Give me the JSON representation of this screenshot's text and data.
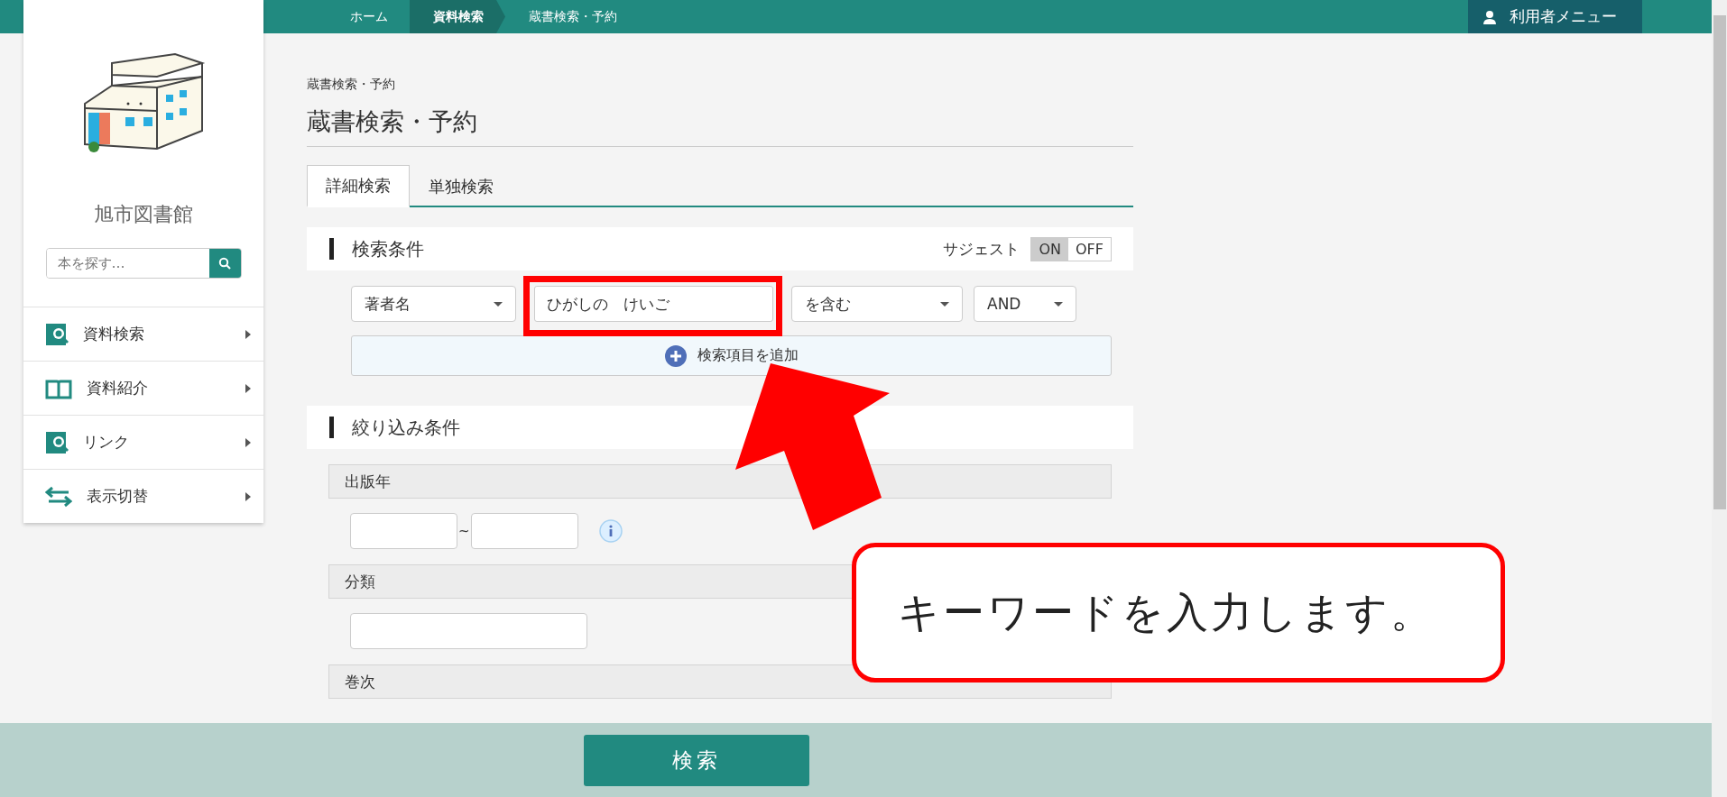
{
  "top_bar": {
    "breadcrumbs": [
      {
        "label": "ホーム",
        "selected": false
      },
      {
        "label": "資料検索",
        "selected": true
      },
      {
        "label": "蔵書検索・予約",
        "selected": false
      }
    ],
    "user_menu": "利用者メニュー"
  },
  "sidebar": {
    "library_name": "旭市図書館",
    "search": {
      "placeholder": "本を探す…"
    },
    "items": [
      {
        "label": "資料検索",
        "kind": "search"
      },
      {
        "label": "資料紹介",
        "kind": "book"
      },
      {
        "label": "リンク",
        "kind": "search"
      },
      {
        "label": "表示切替",
        "kind": "switch"
      }
    ]
  },
  "page": {
    "breadcrumb": "蔵書検索・予約",
    "title": "蔵書検索・予約",
    "tabs": [
      {
        "label": "詳細検索",
        "selected": true
      },
      {
        "label": "単独検索",
        "selected": false
      }
    ],
    "conditions": {
      "heading": "検索条件",
      "suggest_label": "サジェスト",
      "suggest_options": [
        {
          "label": "ON",
          "selected": true
        },
        {
          "label": "OFF",
          "selected": false
        }
      ],
      "field": "著者名",
      "value": "ひがしの　けいご",
      "match": "を含む",
      "operator": "AND",
      "add_button": "検索項目を追加"
    },
    "filters": {
      "heading": "絞り込み条件",
      "groups": [
        {
          "label": "出版年",
          "kind": "range",
          "separator": "~"
        },
        {
          "label": "分類",
          "kind": "text"
        },
        {
          "label": "巻次",
          "kind": "none"
        }
      ]
    }
  },
  "search_button": "検索",
  "annotation": {
    "text": "キーワードを入力します。"
  }
}
